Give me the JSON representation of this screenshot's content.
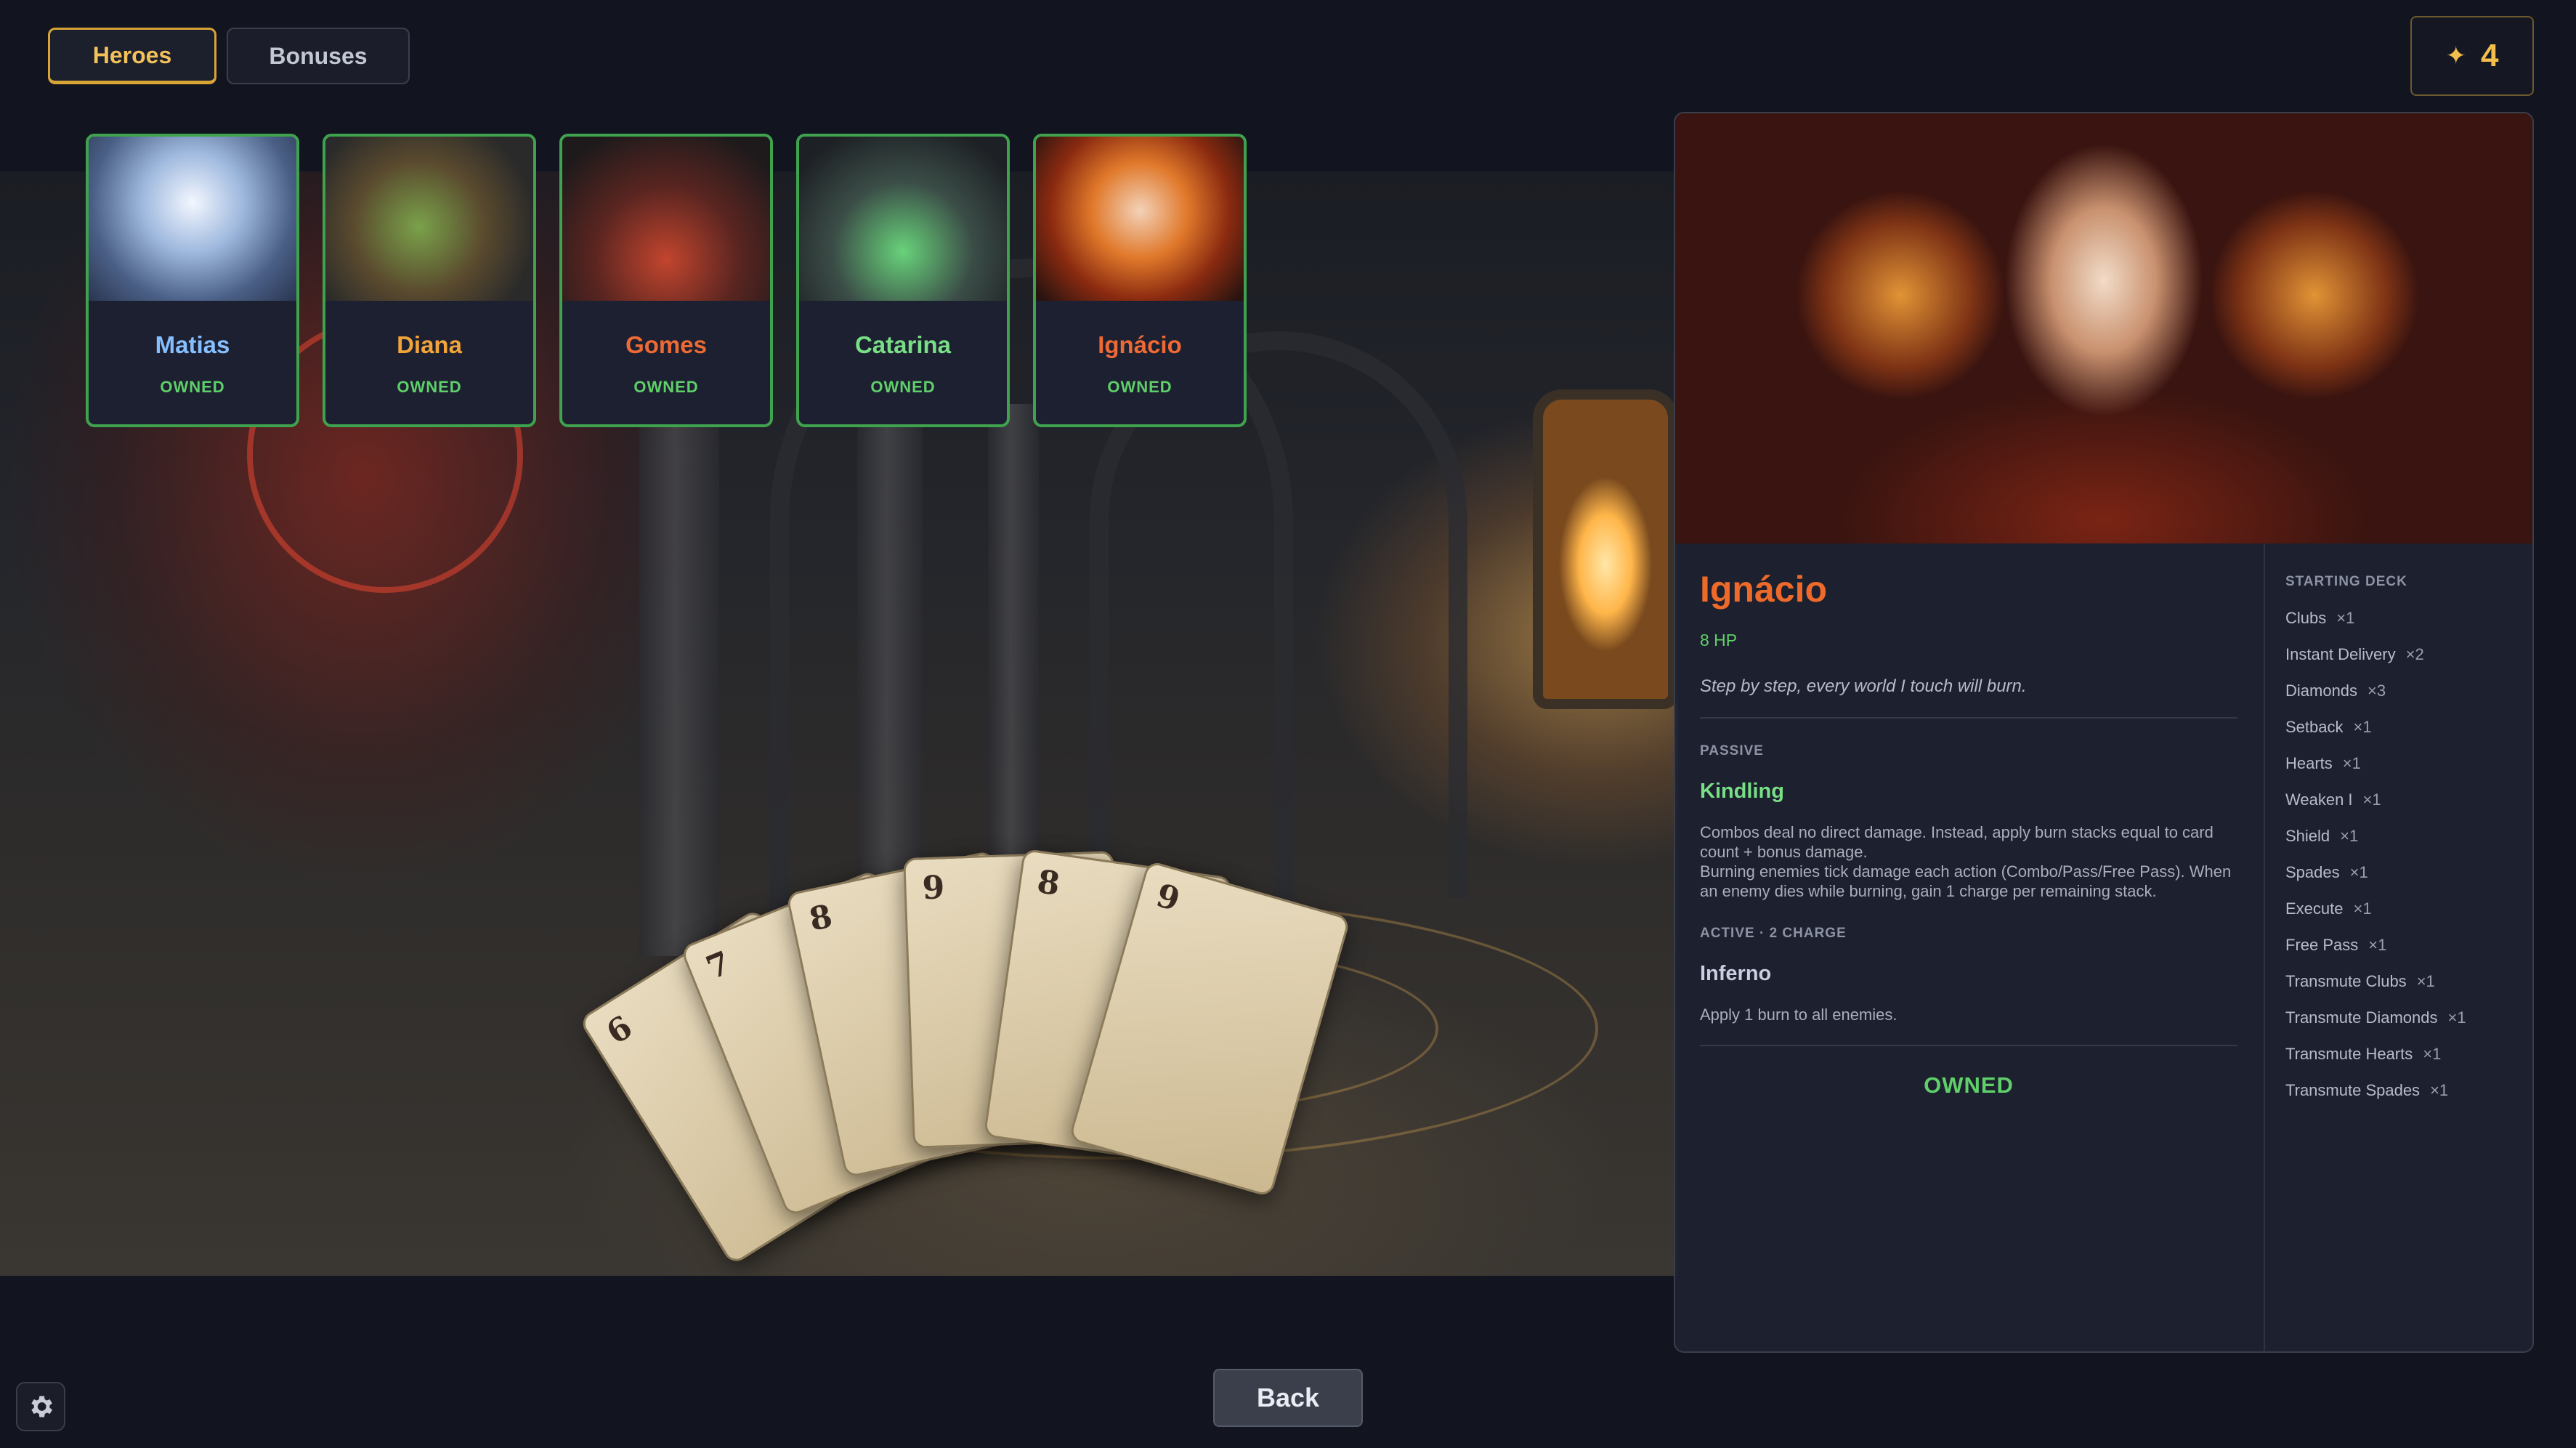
{
  "tabs": [
    {
      "label": "Heroes",
      "active": true
    },
    {
      "label": "Bonuses",
      "active": false
    }
  ],
  "currency": {
    "icon": "star-icon",
    "value": "4",
    "color": "#f1bd4c"
  },
  "heroes": [
    {
      "name": "Matias",
      "status": "OWNED",
      "color": "#86bfff"
    },
    {
      "name": "Diana",
      "status": "OWNED",
      "color": "#f1a43a"
    },
    {
      "name": "Gomes",
      "status": "OWNED",
      "color": "#ee6a35"
    },
    {
      "name": "Catarina",
      "status": "OWNED",
      "color": "#78df86"
    },
    {
      "name": "Ignácio",
      "status": "OWNED",
      "color": "#ee6a35"
    }
  ],
  "background_cards": [
    "6",
    "7",
    "8",
    "9",
    "8",
    "9"
  ],
  "selected_hero": {
    "name": "Ignácio",
    "hp": "8 HP",
    "quote": "Step by step, every world I touch will burn.",
    "passive": {
      "label": "PASSIVE",
      "name": "Kindling",
      "description": "Combos deal no direct damage. Instead, apply burn stacks equal to card count + bonus damage.\nBurning enemies tick damage each action (Combo/Pass/Free Pass). When an enemy dies while burning, gain 1 charge per remaining stack."
    },
    "active": {
      "label": "ACTIVE",
      "charge": "2 CHARGE",
      "name": "Inferno",
      "description": "Apply 1 burn to all enemies."
    },
    "status": "OWNED",
    "deck_title": "STARTING DECK",
    "deck": [
      {
        "card": "Clubs",
        "count": "×1"
      },
      {
        "card": "Instant Delivery",
        "count": "×2"
      },
      {
        "card": "Diamonds",
        "count": "×3"
      },
      {
        "card": "Setback",
        "count": "×1"
      },
      {
        "card": "Hearts",
        "count": "×1"
      },
      {
        "card": "Weaken I",
        "count": "×1"
      },
      {
        "card": "Shield",
        "count": "×1"
      },
      {
        "card": "Spades",
        "count": "×1"
      },
      {
        "card": "Execute",
        "count": "×1"
      },
      {
        "card": "Free Pass",
        "count": "×1"
      },
      {
        "card": "Transmute Clubs",
        "count": "×1"
      },
      {
        "card": "Transmute Diamonds",
        "count": "×1"
      },
      {
        "card": "Transmute Hearts",
        "count": "×1"
      },
      {
        "card": "Transmute Spades",
        "count": "×1"
      }
    ]
  },
  "back_button": "Back",
  "settings_icon": "gear-icon"
}
